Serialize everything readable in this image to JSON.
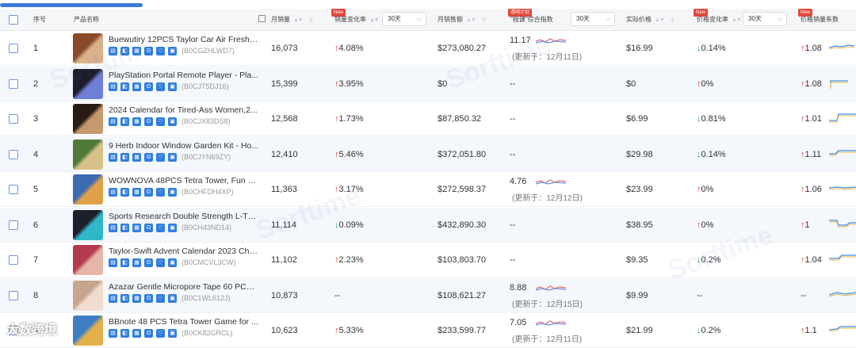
{
  "header": {
    "index": "序号",
    "product_name": "产品名称",
    "monthly_sales": "月销量",
    "sales_change": "销量变化率",
    "period_1": "30天",
    "monthly_revenue": "月销售额",
    "transparent_badge": "透明计划",
    "composite_index": "\"稳健\"综合指数",
    "period_2": "30天",
    "actual_price": "实际价格",
    "price_change": "价格变化率",
    "period_3": "30天",
    "price_sales_coef": "价格销量系数",
    "new_badge": "New"
  },
  "watermark": "Sorftime",
  "logo_watermark": "大数跨境",
  "rows": [
    {
      "idx": "1",
      "name": "Buewutiry 12PCS Taylor Car Air Freshe...",
      "asin": "(B0CGZHLWD7)",
      "sales": "16,073",
      "sales_change": "4.08%",
      "sales_dir": "up",
      "revenue": "$273,080.27",
      "index_value": "11.17",
      "index_updated": "(更新于：12月11日)",
      "price": "$16.99",
      "price_change": "0.14%",
      "price_dir": "down",
      "coef": "1.08",
      "coef_dir": "up"
    },
    {
      "idx": "2",
      "name": "PlayStation Portal Remote Player - Pla...",
      "asin": "(B0CJT5DJ16)",
      "sales": "15,399",
      "sales_change": "3.95%",
      "sales_dir": "up",
      "revenue": "$0",
      "index_value": "--",
      "index_updated": "",
      "price": "$0",
      "price_change": "0%",
      "price_dir": "up",
      "coef": "1.08",
      "coef_dir": "up"
    },
    {
      "idx": "3",
      "name": "2024 Calendar for Tired-Ass Women,2...",
      "asin": "(B0CJX83DS8)",
      "sales": "12,568",
      "sales_change": "1.73%",
      "sales_dir": "up",
      "revenue": "$87,850.32",
      "index_value": "--",
      "index_updated": "",
      "price": "$6.99",
      "price_change": "0.81%",
      "price_dir": "down",
      "coef": "1.01",
      "coef_dir": "up"
    },
    {
      "idx": "4",
      "name": "9 Herb Indoor Window Garden Kit - Ho...",
      "asin": "(B0CJYN69ZY)",
      "sales": "12,410",
      "sales_change": "5.46%",
      "sales_dir": "up",
      "revenue": "$372,051.80",
      "index_value": "--",
      "index_updated": "",
      "price": "$29.98",
      "price_change": "0.14%",
      "price_dir": "down",
      "coef": "1.11",
      "coef_dir": "up"
    },
    {
      "idx": "5",
      "name": "WOWNOVA 48PCS Tetra Tower, Fun B...",
      "asin": "(B0CHFDH4XP)",
      "sales": "11,363",
      "sales_change": "3.17%",
      "sales_dir": "up",
      "revenue": "$272,598.37",
      "index_value": "4.76",
      "index_updated": "(更新于：12月12日)",
      "price": "$23.99",
      "price_change": "0%",
      "price_dir": "up",
      "coef": "1.06",
      "coef_dir": "up"
    },
    {
      "idx": "6",
      "name": "Sports Research Double Strength L-Th...",
      "asin": "(B0CH43ND14)",
      "sales": "11,114",
      "sales_change": "0.09%",
      "sales_dir": "down",
      "revenue": "$432,890.30",
      "index_value": "--",
      "index_updated": "",
      "price": "$38.95",
      "price_change": "0%",
      "price_dir": "up",
      "coef": "1",
      "coef_dir": "up"
    },
    {
      "idx": "7",
      "name": "Taylor-Swift Advent Calendar 2023 Chri...",
      "asin": "(B0CMCVL3CW)",
      "sales": "11,102",
      "sales_change": "2.23%",
      "sales_dir": "up",
      "revenue": "$103,803.70",
      "index_value": "--",
      "index_updated": "",
      "price": "$9.35",
      "price_change": "0.2%",
      "price_dir": "down",
      "coef": "1.04",
      "coef_dir": "up"
    },
    {
      "idx": "8",
      "name": "Azazar Gentle Micropore Tape 60 PCS ...",
      "asin": "(B0C1WL612J)",
      "sales": "10,873",
      "sales_change": "--",
      "sales_dir": "none",
      "revenue": "$108,621.27",
      "index_value": "8.88",
      "index_updated": "(更新于：12月15日)",
      "price": "$9.99",
      "price_change": "--",
      "price_dir": "none",
      "coef": "--",
      "coef_dir": "none"
    },
    {
      "idx": "9",
      "name": "BBnote 48 PCS Tetra Tower Game for ...",
      "asin": "(B0CK82GRCL)",
      "sales": "10,623",
      "sales_change": "5.33%",
      "sales_dir": "up",
      "revenue": "$233,599.77",
      "index_value": "7.05",
      "index_updated": "(更新于：12月11日)",
      "price": "$21.99",
      "price_change": "0.2%",
      "price_dir": "down",
      "coef": "1.1",
      "coef_dir": "up"
    }
  ],
  "arrows": {
    "up": "↑",
    "down": "↓"
  },
  "colors": {
    "accent": "#2f7de1",
    "up": "#e2473b",
    "down": "#19a463",
    "header_bg": "#f5f6f8",
    "row_alt": "#f4f7fb"
  }
}
